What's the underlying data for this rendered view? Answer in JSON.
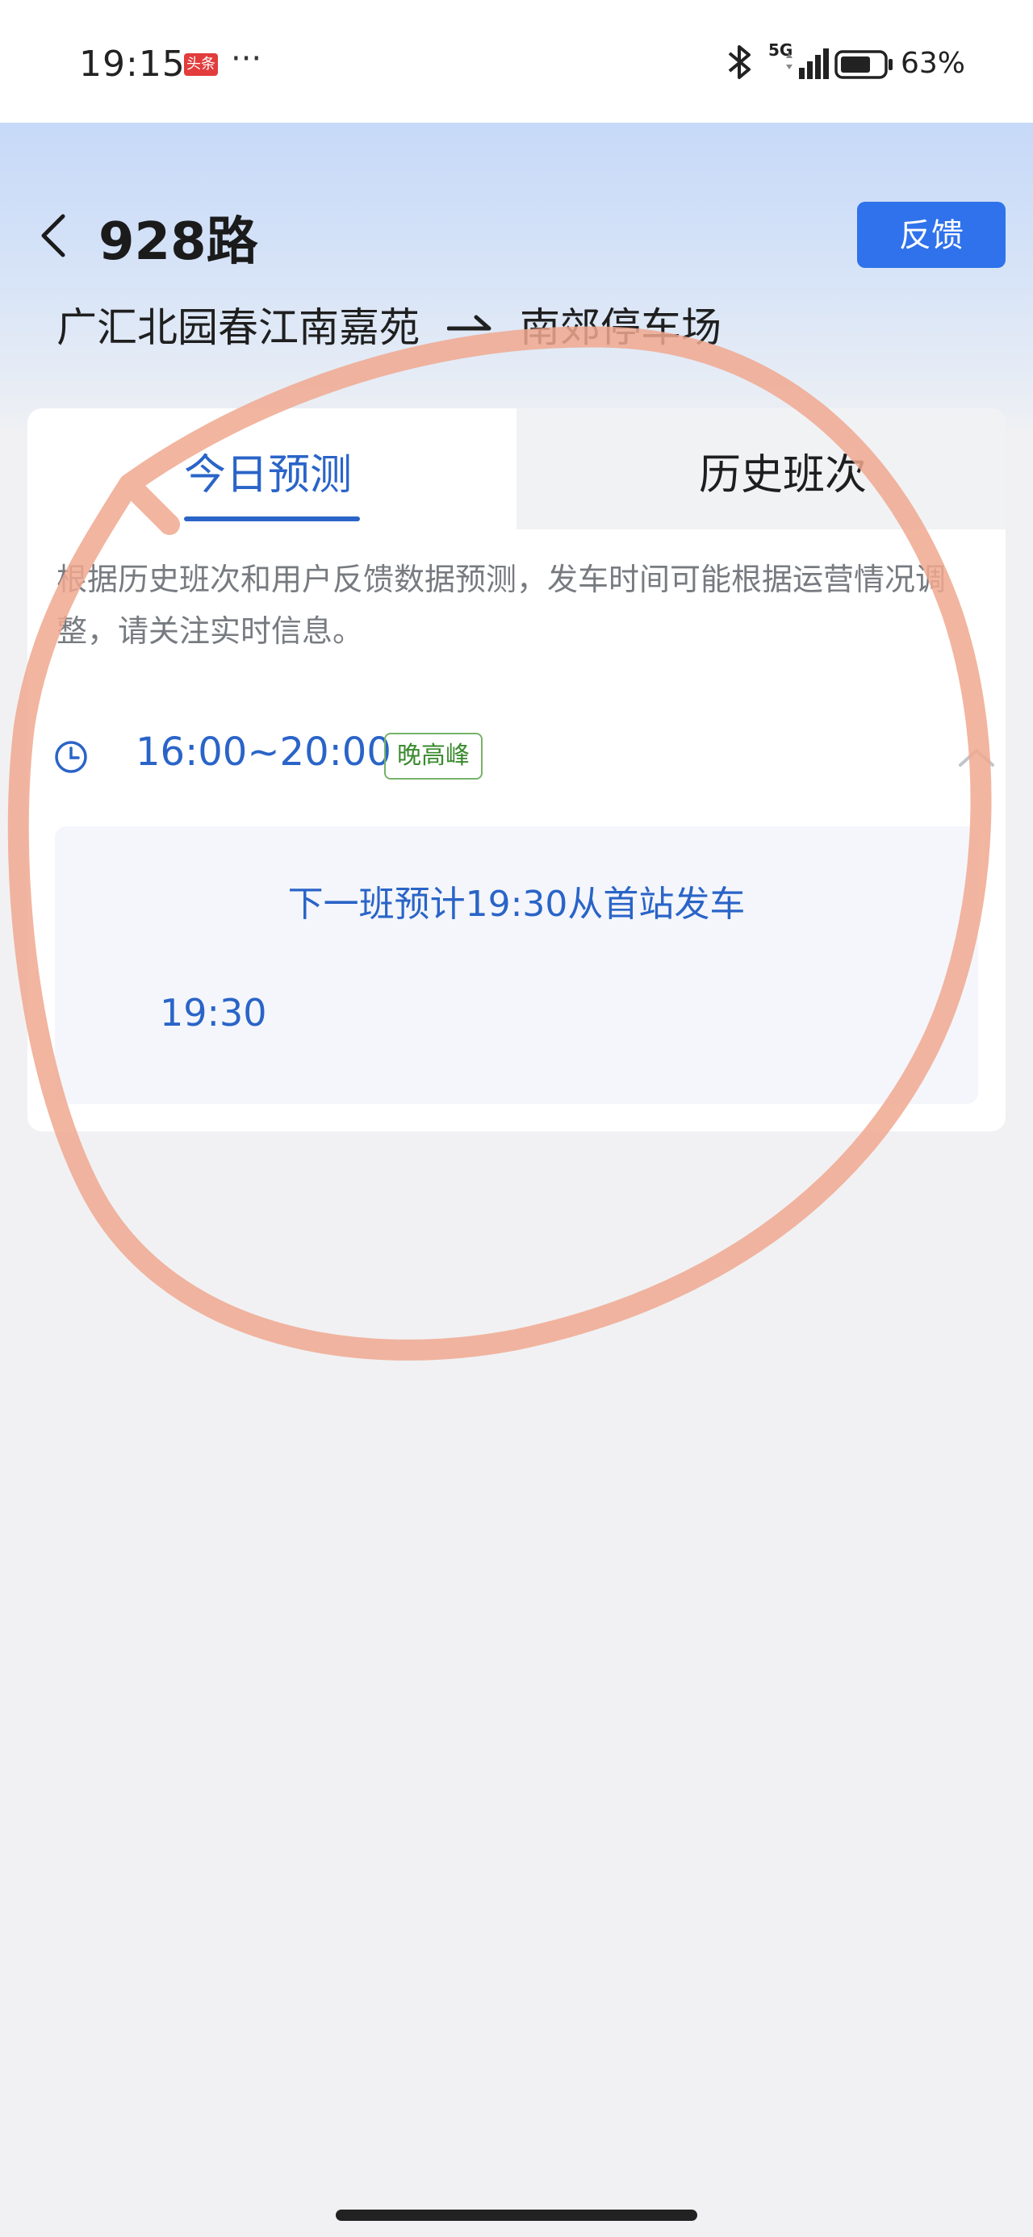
{
  "status_bar": {
    "time": "19:15",
    "news_badge": "头条",
    "more": "···",
    "network": "5G",
    "battery": "63%"
  },
  "header": {
    "route_name": "928路",
    "feedback_label": "反馈",
    "origin": "广汇北园春江南嘉苑",
    "destination": "南郊停车场"
  },
  "tabs": [
    {
      "label": "今日预测",
      "active": true
    },
    {
      "label": "历史班次",
      "active": false
    }
  ],
  "note": "根据历史班次和用户反馈数据预测，发车时间可能根据运营情况调整，请关注实时信息。",
  "period": {
    "time_range": "16:00~20:00",
    "badge": "晚高峰"
  },
  "schedule": {
    "next_bus_text": "下一班预计19:30从首站发车",
    "departure_time": "19:30"
  },
  "colors": {
    "accent": "#2a64c8",
    "feedback_button": "#2f72eb",
    "peak_badge": "#3a8a2d",
    "annotation_stroke": "#f0a88f"
  }
}
